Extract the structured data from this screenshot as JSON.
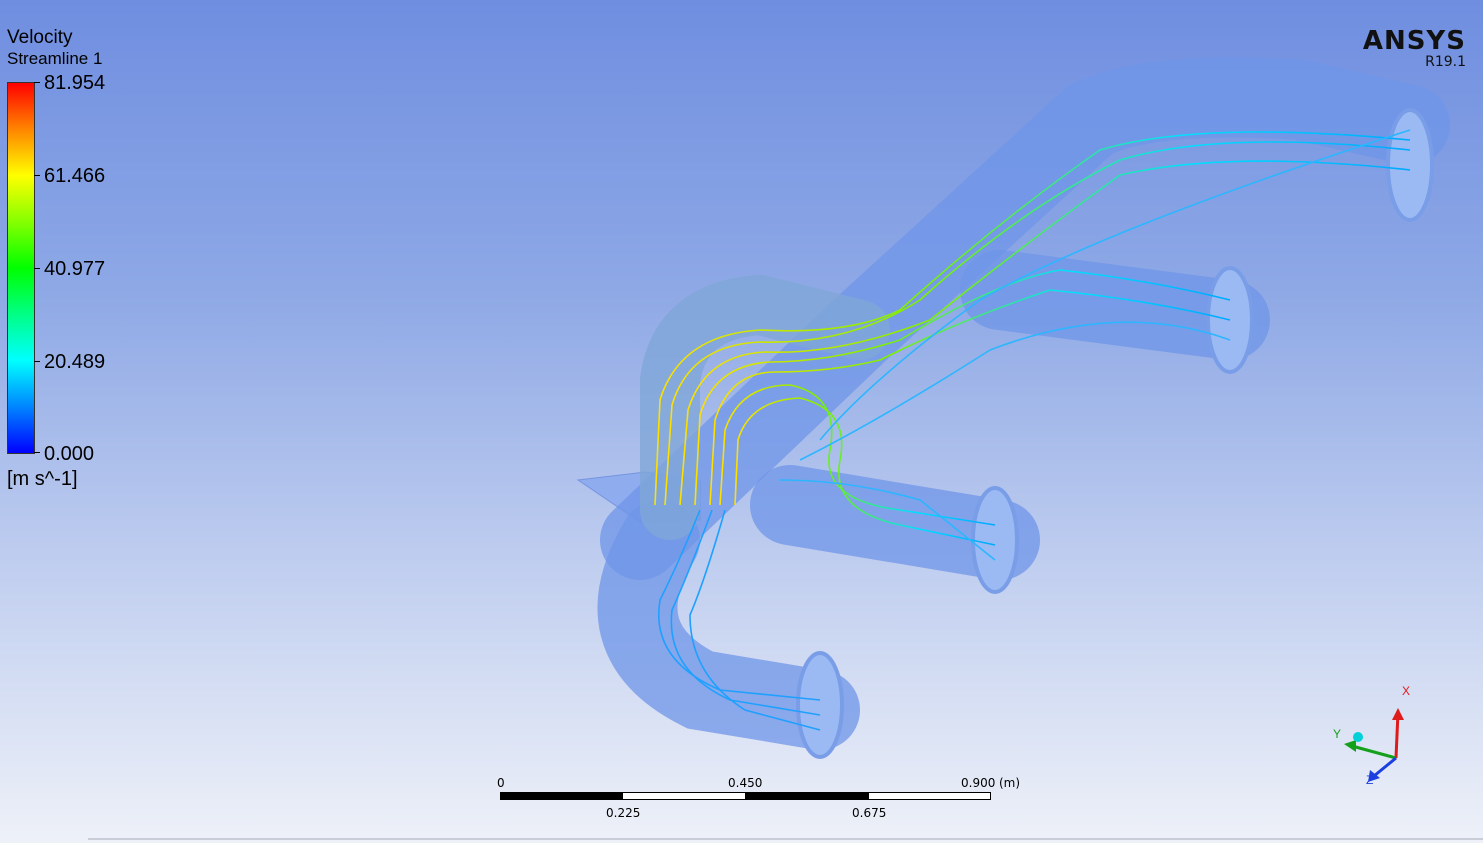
{
  "legend": {
    "variable": "Velocity",
    "object": "Streamline 1",
    "max": "81.954",
    "v3": "61.466",
    "v2": "40.977",
    "v1": "20.489",
    "min": "0.000",
    "unit": "[m s^-1]",
    "colormap_stops": [
      "#ff0000",
      "#ffff00",
      "#00ff00",
      "#00ffff",
      "#0000ff"
    ]
  },
  "brand": {
    "name": "ANSYS",
    "version": "R19.1"
  },
  "scale": {
    "labels_top": [
      "0",
      "0.450",
      "0.900"
    ],
    "unit": "(m)",
    "labels_bottom": [
      "0.225",
      "0.675"
    ]
  },
  "triad": {
    "x": "X",
    "y": "Y",
    "z": "Z"
  },
  "colors": {
    "pipe": "#6f95e8",
    "axis_x": "#e01b1b",
    "axis_y": "#14a01a",
    "axis_z": "#1c3fe0"
  }
}
